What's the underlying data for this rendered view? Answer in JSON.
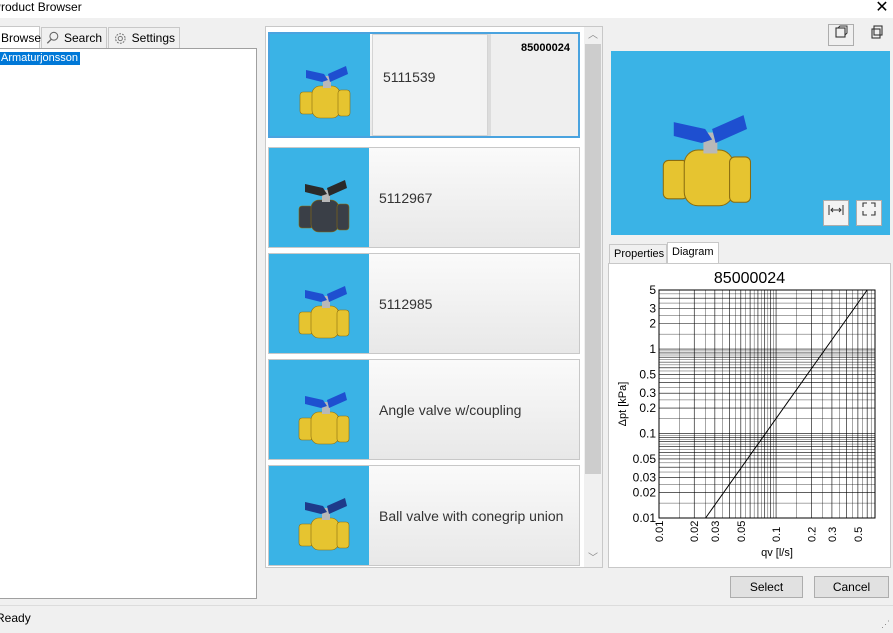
{
  "window": {
    "title": "Product Browser",
    "close": "✕"
  },
  "left_tabs": [
    {
      "label": "Browse"
    },
    {
      "label": "Search"
    },
    {
      "label": "Settings"
    }
  ],
  "tree": {
    "selected_item": "Armaturjonsson"
  },
  "products": [
    {
      "label": "5111539",
      "code": "85000024",
      "selected": true,
      "handle_color": "#1e4fd0"
    },
    {
      "label": "5112967",
      "selected": false,
      "handle_color": "#2a2a2a"
    },
    {
      "label": "5112985",
      "selected": false,
      "handle_color": "#1e4fd0"
    },
    {
      "label": "Angle valve w/coupling",
      "selected": false,
      "handle_color": "#1e4fd0"
    },
    {
      "label": "Ball valve with conegrip union",
      "selected": false,
      "handle_color": "#1e3a8a"
    }
  ],
  "right_tabs": [
    {
      "label": "Properties",
      "active": false
    },
    {
      "label": "Diagram",
      "active": true
    }
  ],
  "chart_data": {
    "type": "line",
    "title": "85000024",
    "xlabel": "qv [l/s]",
    "ylabel": "Δpt [kPa]",
    "x_scale": "log",
    "y_scale": "log",
    "xlim": [
      0.01,
      0.7
    ],
    "ylim": [
      0.01,
      5
    ],
    "x_ticks": [
      "0.01",
      "0.02",
      "0.03",
      "0.05",
      "0.1",
      "0.2",
      "0.3",
      "0.5"
    ],
    "y_ticks": [
      "0.01",
      "0.02",
      "0.03",
      "0.05",
      "0.1",
      "0.2",
      "0.3",
      "0.5",
      "1",
      "2",
      "3",
      "5"
    ],
    "grid": true,
    "series": [
      {
        "x": [
          0.025,
          0.6
        ],
        "y": [
          0.01,
          5
        ]
      }
    ]
  },
  "buttons": {
    "select": "Select",
    "cancel": "Cancel"
  },
  "status": {
    "text": "Ready"
  },
  "colors": {
    "accent": "#0078d7",
    "preview_bg": "#3ab3e6",
    "selected_border": "#4aa3df",
    "valve_body": "#e6c430"
  }
}
